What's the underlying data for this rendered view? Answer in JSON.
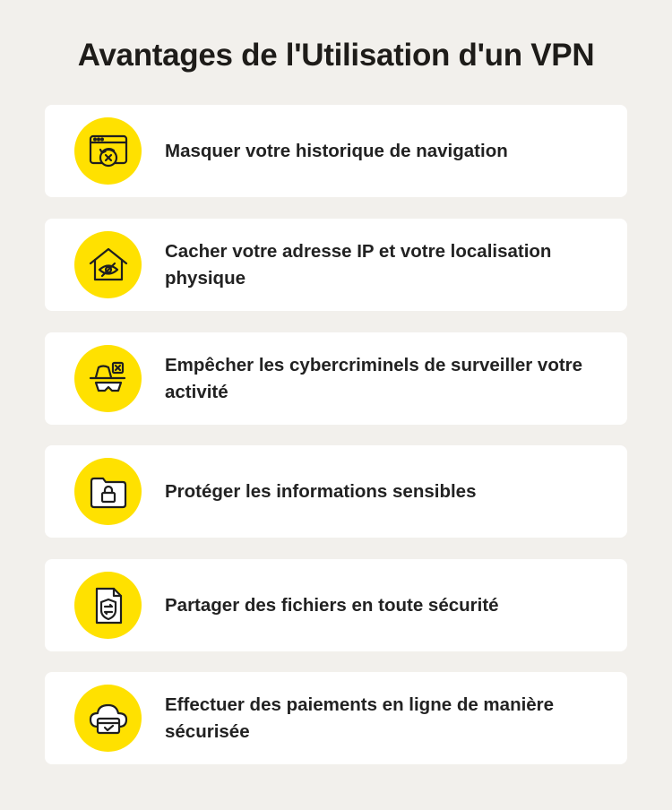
{
  "title": "Avantages de l'Utilisation d'un VPN",
  "colors": {
    "background": "#f2f0ec",
    "card": "#ffffff",
    "accent": "#ffe100",
    "text": "#222222"
  },
  "items": [
    {
      "label": "Masquer votre historique de navigation",
      "icon": "browser-history-clear-icon"
    },
    {
      "label": "Cacher votre adresse IP et votre localisation physique",
      "icon": "house-hidden-eye-icon"
    },
    {
      "label": "Empêcher les cybercriminels de surveiller votre activité",
      "icon": "spy-hacker-icon"
    },
    {
      "label": "Protéger les informations sensibles",
      "icon": "locked-folder-icon"
    },
    {
      "label": "Partager des fichiers en toute sécurité",
      "icon": "secure-file-transfer-icon"
    },
    {
      "label": "Effectuer des paiements en ligne de manière sécurisée",
      "icon": "cloud-payment-card-icon"
    }
  ]
}
